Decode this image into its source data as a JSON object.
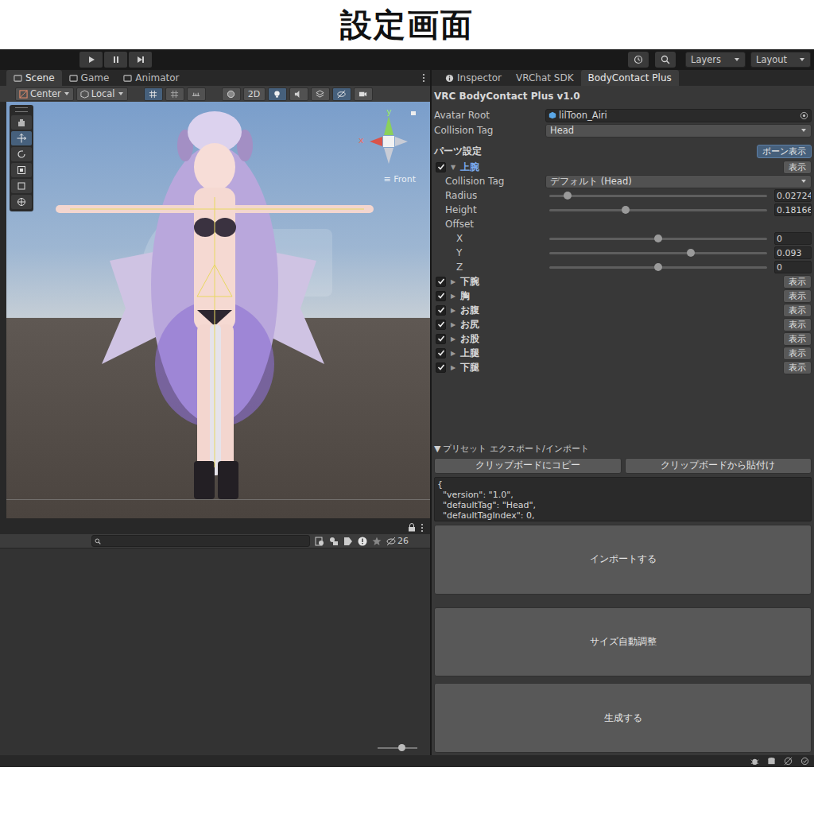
{
  "page_title": "設定画面",
  "main_toolbar": {
    "layers": "Layers",
    "layout": "Layout"
  },
  "left_tabs": [
    {
      "label": "Scene",
      "selected": true
    },
    {
      "label": "Game",
      "selected": false
    },
    {
      "label": "Animator",
      "selected": false
    }
  ],
  "scene_toolbar": {
    "pivot": "Center",
    "space": "Local",
    "mode_2d": "2D"
  },
  "viewport": {
    "axis_y": "y",
    "axis_x": "x",
    "view_label": "≡ Front"
  },
  "hierarchy": {
    "hidden_count": "26"
  },
  "right_tabs": [
    {
      "label": "Inspector",
      "selected": false
    },
    {
      "label": "VRChat SDK",
      "selected": false
    },
    {
      "label": "BodyContact Plus",
      "selected": true
    }
  ],
  "tool": {
    "title": "VRC BodyContact Plus v1.0",
    "avatar_root": {
      "label": "Avatar Root",
      "value": "lilToon_Airi"
    },
    "collision_tag": {
      "label": "Collision Tag",
      "value": "Head"
    },
    "parts_heading": "パーツ設定",
    "bone_button": "ボーン表示",
    "parts": [
      {
        "name": "上腕",
        "enabled": true,
        "expanded": true,
        "selected": true,
        "arrow": "▼",
        "button": "表示",
        "fields": [
          {
            "kind": "dropdown",
            "label": "Collision Tag",
            "value": "デフォルト (Head)"
          },
          {
            "kind": "slider",
            "label": "Radius",
            "level": 0.084,
            "value": "0.02724"
          },
          {
            "kind": "slider",
            "label": "Height",
            "level": 0.35,
            "value": "0.18166"
          },
          {
            "kind": "header",
            "label": "Offset"
          },
          {
            "kind": "axis",
            "label": "X",
            "level": 0.5,
            "value": "0"
          },
          {
            "kind": "axis",
            "label": "Y",
            "level": 0.65,
            "value": "0.093"
          },
          {
            "kind": "axis",
            "label": "Z",
            "level": 0.5,
            "value": "0"
          }
        ]
      },
      {
        "name": "下腕",
        "enabled": true,
        "expanded": false,
        "selected": false,
        "arrow": "▶",
        "button": "表示",
        "fields": []
      },
      {
        "name": "胸",
        "enabled": true,
        "expanded": false,
        "selected": false,
        "arrow": "▶",
        "button": "表示",
        "fields": []
      },
      {
        "name": "お腹",
        "enabled": true,
        "expanded": false,
        "selected": false,
        "arrow": "▶",
        "button": "表示",
        "fields": []
      },
      {
        "name": "お尻",
        "enabled": true,
        "expanded": false,
        "selected": false,
        "arrow": "▶",
        "button": "表示",
        "fields": []
      },
      {
        "name": "お股",
        "enabled": true,
        "expanded": false,
        "selected": false,
        "arrow": "▶",
        "button": "表示",
        "fields": []
      },
      {
        "name": "上腿",
        "enabled": true,
        "expanded": false,
        "selected": false,
        "arrow": "▶",
        "button": "表示",
        "fields": []
      },
      {
        "name": "下腿",
        "enabled": true,
        "expanded": false,
        "selected": false,
        "arrow": "▶",
        "button": "表示",
        "fields": []
      }
    ],
    "preset": {
      "arrow": "▼",
      "header": "プリセット エクスポート/インポート",
      "expanded": true,
      "copy": "クリップボードにコピー",
      "paste": "クリップボードから貼付け",
      "json_lines": [
        "{",
        "  \"version\": \"1.0\",",
        "  \"defaultTag\": \"Head\",",
        "  \"defaultTagIndex\": 0,"
      ],
      "import": "インポートする"
    },
    "auto_size": "サイズ自動調整",
    "generate": "生成する"
  }
}
